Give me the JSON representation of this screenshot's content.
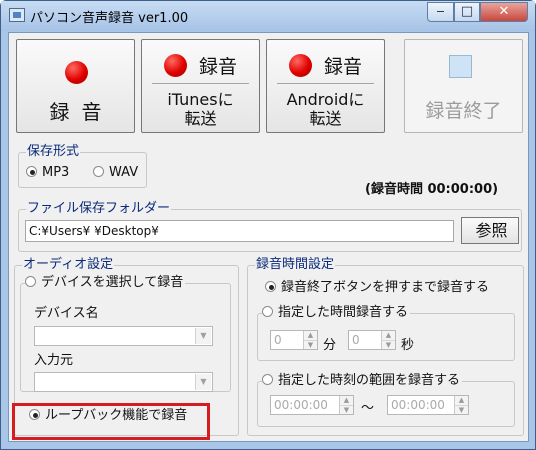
{
  "window": {
    "title": "パソコン音声録音 ver1.00",
    "min": "‒",
    "max": "□",
    "close": "✕"
  },
  "buttons": {
    "record": "録音",
    "itunes_head": "録音",
    "itunes_sub1": "iTunesに",
    "itunes_sub2": "転送",
    "android_head": "録音",
    "android_sub1": "Androidに",
    "android_sub2": "転送",
    "stop": "録音終了"
  },
  "format": {
    "label": "保存形式",
    "mp3": "MP3",
    "wav": "WAV",
    "selected": "MP3"
  },
  "timer": "(録音時間 00:00:00)",
  "folder": {
    "label": "ファイル保存フォルダー",
    "path": "C:¥Users¥            ¥Desktop¥",
    "browse": "参照"
  },
  "audio": {
    "label": "オーディオ設定",
    "device_radio": "デバイスを選択して録音",
    "device_name": "デバイス名",
    "input_source": "入力元",
    "loopback": "ループバック機能で録音",
    "selected": "loopback"
  },
  "rectime": {
    "label": "録音時間設定",
    "until_stop": "録音終了ボタンを押すまで録音する",
    "specified": "指定した時間録音する",
    "min_value": "0",
    "min_unit": "分",
    "sec_value": "0",
    "sec_unit": "秒",
    "range": "指定した時刻の範囲を録音する",
    "from": "00:00:00",
    "tilde": "～",
    "to": "00:00:00",
    "selected": "until_stop"
  }
}
